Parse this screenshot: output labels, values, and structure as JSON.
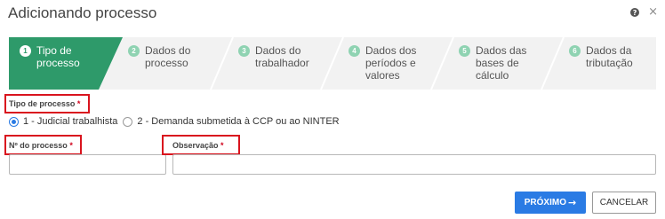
{
  "dialog": {
    "title": "Adicionando processo"
  },
  "steps": [
    {
      "num": "1",
      "label": "Tipo de processo",
      "active": true
    },
    {
      "num": "2",
      "label": "Dados do processo",
      "active": false
    },
    {
      "num": "3",
      "label": "Dados do trabalhador",
      "active": false
    },
    {
      "num": "4",
      "label": "Dados dos períodos e valores",
      "active": false
    },
    {
      "num": "5",
      "label": "Dados das bases de cálculo",
      "active": false
    },
    {
      "num": "6",
      "label": "Dados da tributação",
      "active": false
    }
  ],
  "form": {
    "tipo_label": "Tipo de processo",
    "required_mark": "*",
    "options": [
      {
        "label": "1 - Judicial trabalhista",
        "selected": true
      },
      {
        "label": "2 - Demanda submetida à CCP ou ao NINTER",
        "selected": false
      }
    ],
    "numero_label": "Nº do processo",
    "numero_value": "",
    "obs_label": "Observação",
    "obs_value": ""
  },
  "buttons": {
    "next": "PRÓXIMO",
    "next_arrow": "→",
    "cancel": "CANCELAR"
  },
  "colors": {
    "active_step": "#2e9a6a",
    "inactive_step": "#f2f2f2",
    "highlight": "#d9141e",
    "primary_button": "#2a7be4"
  }
}
